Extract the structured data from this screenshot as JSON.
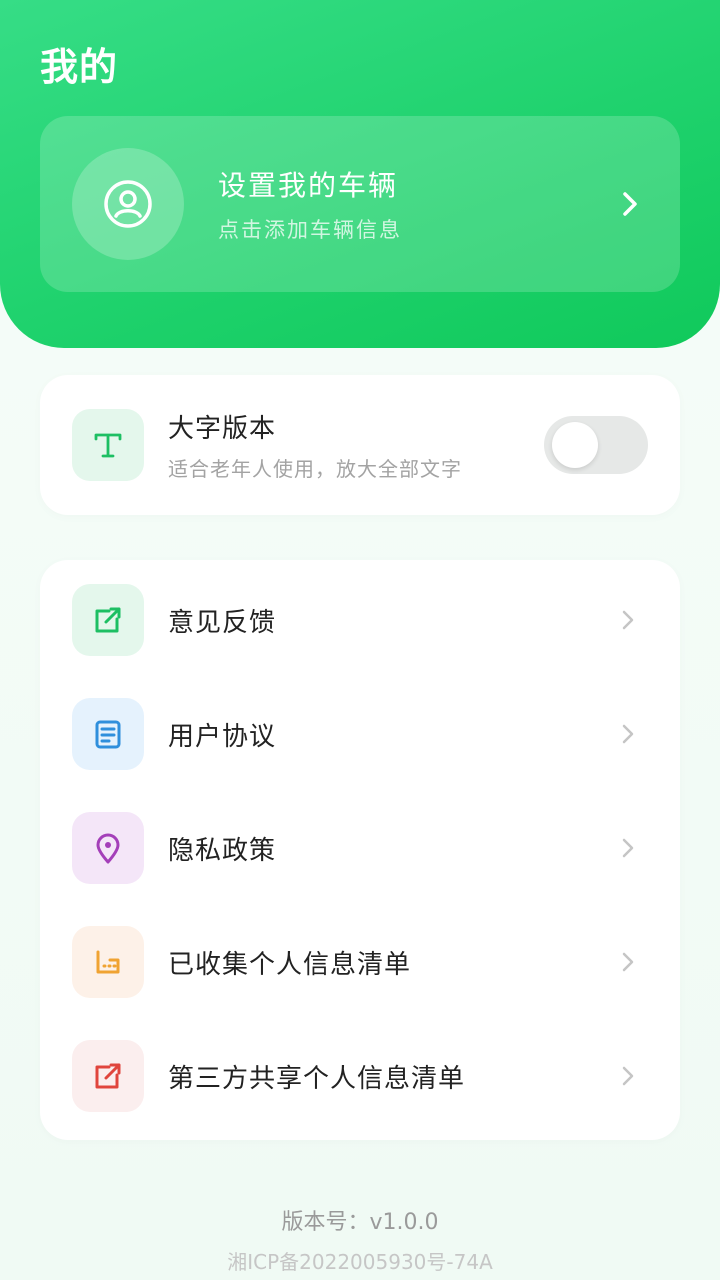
{
  "header": {
    "title": "我的",
    "vehicle_card": {
      "title": "设置我的车辆",
      "subtitle": "点击添加车辆信息",
      "avatar_icon": "user-circle-icon",
      "chevron_icon": "chevron-right-icon"
    }
  },
  "large_font": {
    "icon": "text-t-icon",
    "label": "大字版本",
    "subtitle": "适合老年人使用，放大全部文字",
    "enabled": false
  },
  "menu": {
    "items": [
      {
        "label": "意见反馈",
        "icon": "feedback-edit-icon",
        "icon_color": "#1dbf63",
        "icon_bg": "#e4f7ec"
      },
      {
        "label": "用户协议",
        "icon": "document-icon",
        "icon_color": "#2f8fdc",
        "icon_bg": "#e5f2fd"
      },
      {
        "label": "隐私政策",
        "icon": "location-pin-icon",
        "icon_color": "#a43fb9",
        "icon_bg": "#f4e6f8"
      },
      {
        "label": "已收集个人信息清单",
        "icon": "folder-list-icon",
        "icon_color": "#f0a332",
        "icon_bg": "#fdf1e8"
      },
      {
        "label": "第三方共享个人信息清单",
        "icon": "share-external-icon",
        "icon_color": "#e0453d",
        "icon_bg": "#fbeeee"
      }
    ]
  },
  "footer": {
    "version": "版本号：v1.0.0",
    "icp": "湘ICP备2022005930号-74A"
  }
}
